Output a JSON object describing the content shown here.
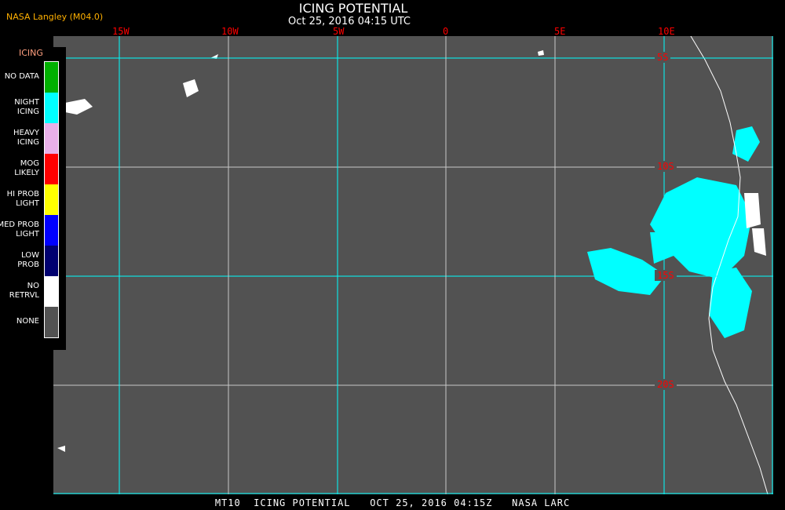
{
  "header": {
    "credit": "NASA Langley (M04.0)",
    "title": "ICING POTENTIAL",
    "datetime": "Oct 25, 2016 04:15 UTC"
  },
  "longitudes": [
    "15W",
    "10W",
    "5W",
    "0",
    "5E",
    "10E"
  ],
  "latitudes": [
    "5S",
    "10S",
    "15S",
    "20S"
  ],
  "legend": {
    "title": "ICING",
    "items": [
      {
        "line1": "NO DATA",
        "line2": "",
        "color": "#00b000"
      },
      {
        "line1": "NIGHT",
        "line2": "ICING",
        "color": "#00ffff"
      },
      {
        "line1": "HEAVY",
        "line2": "ICING",
        "color": "#e8b0e8"
      },
      {
        "line1": "MOG",
        "line2": "LIKELY",
        "color": "#ff0000"
      },
      {
        "line1": "HI PROB",
        "line2": "LIGHT",
        "color": "#ffff00"
      },
      {
        "line1": "MED PROB",
        "line2": "LIGHT",
        "color": "#0000ff"
      },
      {
        "line1": "LOW",
        "line2": "PROB",
        "color": "#000070"
      },
      {
        "line1": "NO",
        "line2": "RETRVL",
        "color": "#ffffff"
      },
      {
        "line1": "NONE",
        "line2": "",
        "color": "#525252"
      }
    ]
  },
  "footer": "MT10  ICING POTENTIAL   OCT 25, 2016 04:15Z   NASA LARC"
}
